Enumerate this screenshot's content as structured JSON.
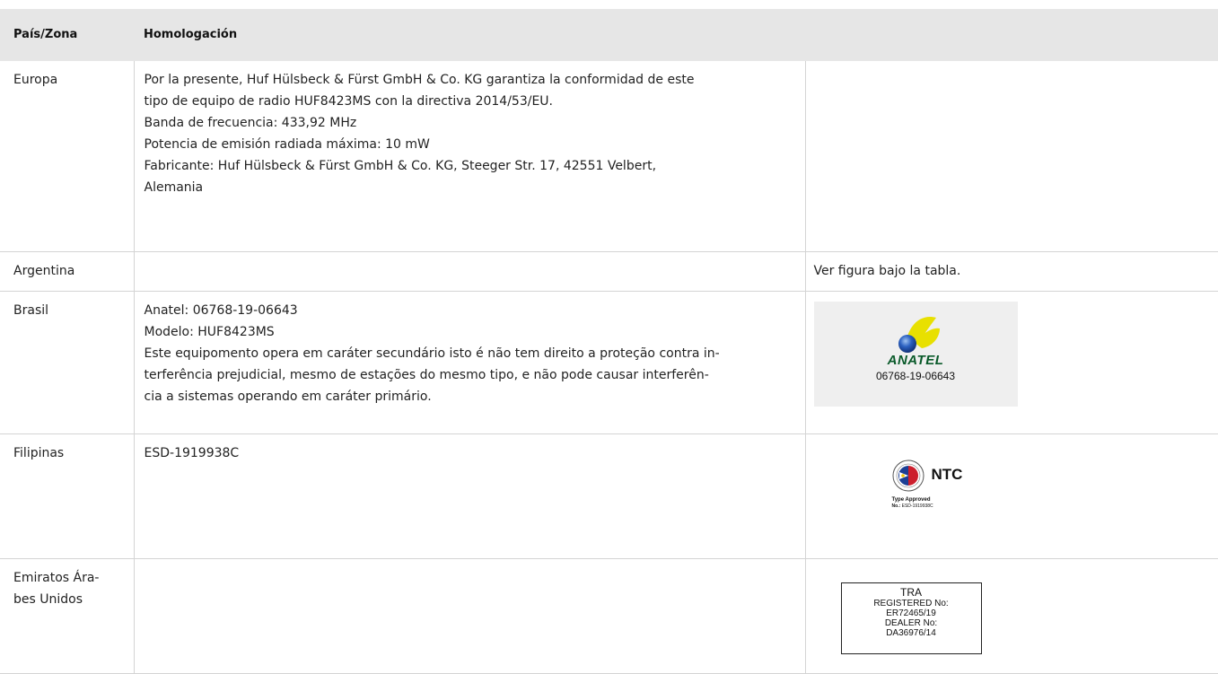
{
  "table": {
    "headers": {
      "country": "País/Zona",
      "approval": "Homologación"
    },
    "rows": [
      {
        "country": "Europa",
        "lines": [
          "Por la presente, Huf Hülsbeck & Fürst GmbH & Co. KG garantiza la conformidad de este",
          "tipo de equipo de radio HUF8423MS con la directiva 2014/53/EU.",
          "Banda de frecuencia: 433,92 MHz",
          "Potencia de emisión radiada máxima: 10 mW",
          "Fabricante: Huf Hülsbeck & Fürst GmbH & Co. KG, Steeger Str. 17, 42551 Velbert,",
          "Alemania"
        ],
        "note": ""
      },
      {
        "country": "Argentina",
        "lines": [],
        "note": "Ver figura bajo la tabla."
      },
      {
        "country": "Brasil",
        "lines": [
          "Anatel: 06768-19-06643",
          "Modelo: HUF8423MS",
          "Este equipomento opera em caráter secundário isto é não tem direito a proteção contra in-",
          "terferência prejudicial, mesmo de estações do mesmo tipo, e não pode causar interferên-",
          "cia a sistemas operando em caráter primário."
        ],
        "logo": {
          "name": "ANATEL",
          "number": "06768-19-06643",
          "colors": {
            "ring": "#e8e000",
            "globe": "#1f4fa8",
            "text": "#0a5a2a",
            "background": "#efefef"
          }
        }
      },
      {
        "country": "Filipinas",
        "lines": [
          "ESD-1919938C"
        ],
        "logo": {
          "name": "NTC",
          "type_approved": "Type Approved",
          "number_label": "No.:",
          "number": "ESD-1919938C",
          "colors": {
            "blue": "#1c3f95",
            "red": "#cc1f2d"
          }
        }
      },
      {
        "country_lines": [
          "Emiratos Ára-",
          "bes Unidos"
        ],
        "lines": [],
        "tra": {
          "lines": [
            "TRA",
            "REGISTERED No:",
            "ER72465/19",
            "DEALER No:",
            "DA36976/14"
          ]
        }
      }
    ]
  },
  "colors": {
    "header_background": "#e6e6e6",
    "border": "#d4d4d4",
    "text": "#222222"
  }
}
